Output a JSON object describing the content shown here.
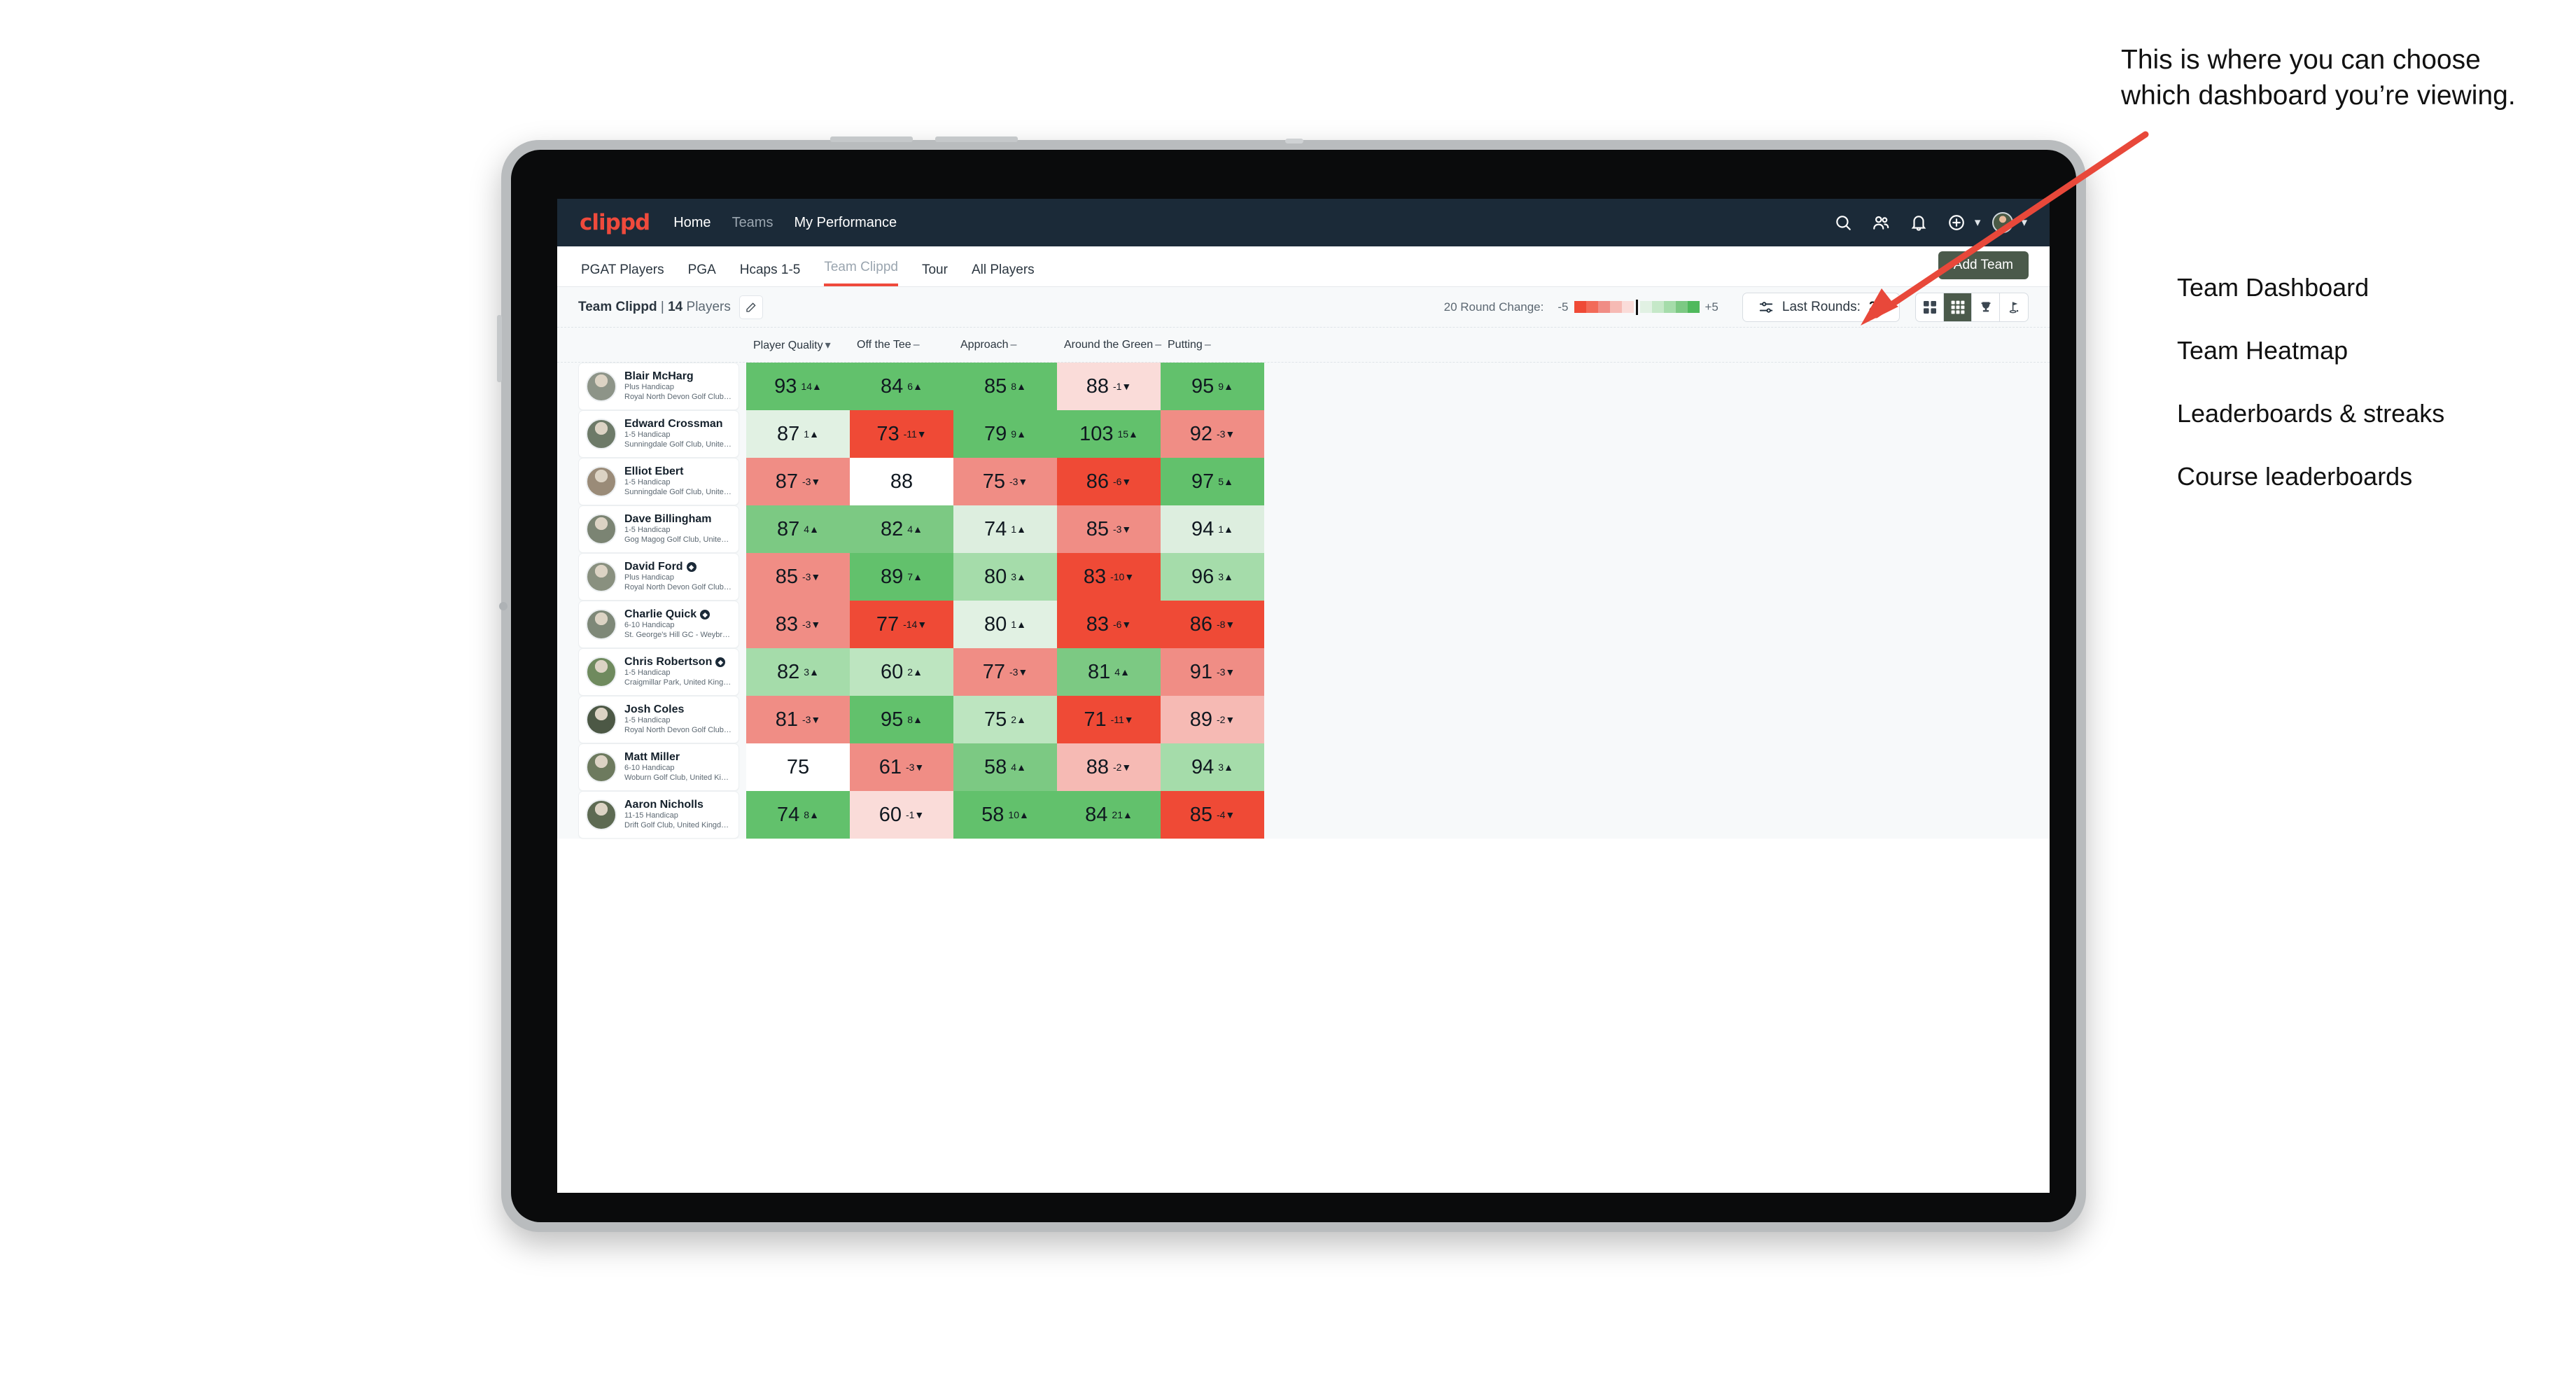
{
  "brand": "clippd",
  "topnav": {
    "links": [
      {
        "label": "Home",
        "dim": false
      },
      {
        "label": "Teams",
        "dim": true
      },
      {
        "label": "My Performance",
        "dim": false
      }
    ],
    "icons": [
      "search-icon",
      "people-icon",
      "bell-icon",
      "plus-circle-icon",
      "avatar"
    ]
  },
  "subnav": {
    "tabs": [
      {
        "label": "PGAT Players",
        "state": "dim-dark"
      },
      {
        "label": "PGA",
        "state": "dim-dark"
      },
      {
        "label": "Hcaps 1-5",
        "state": "dim-dark"
      },
      {
        "label": "Team Clippd",
        "state": "active"
      },
      {
        "label": "Tour",
        "state": "dim-dark"
      },
      {
        "label": "All Players",
        "state": "dim-dark"
      }
    ],
    "add_team_label": "Add Team"
  },
  "toolbar": {
    "team_name": "Team Clippd",
    "separator": "|",
    "player_count": "14",
    "players_label": "Players",
    "edit_icon": "pencil-icon",
    "round_change_label": "20 Round Change:",
    "scale_min": "-5",
    "scale_max": "+5",
    "last_rounds_label": "Last Rounds:",
    "last_rounds_value": "20",
    "filter_icon": "sliders-icon",
    "views": [
      {
        "name": "cards-view",
        "icon": "grid-2x2-icon",
        "active": false
      },
      {
        "name": "heatmap-view",
        "icon": "grid-3x3-icon",
        "active": true
      },
      {
        "name": "leaderboard-view",
        "icon": "trophy-icon",
        "active": false
      },
      {
        "name": "course-view",
        "icon": "flag-pin-icon",
        "active": false
      }
    ]
  },
  "columns": [
    {
      "label": "Player Quality",
      "marker": "chevron-down"
    },
    {
      "label": "Off the Tee",
      "marker": "dash"
    },
    {
      "label": "Approach",
      "marker": "dash"
    },
    {
      "label": "Around the Green",
      "marker": "dash"
    },
    {
      "label": "Putting",
      "marker": "dash"
    }
  ],
  "rows": [
    {
      "name": "Blair McHarg",
      "verified": false,
      "handicap": "Plus Handicap",
      "club": "Royal North Devon Golf Club, United Kingdom",
      "avatar": "#7f8d7a",
      "cells": [
        {
          "value": "93",
          "delta": "14",
          "dir": "up",
          "bg": "#61c濃"
        },
        {
          "value": "84",
          "delta": "6",
          "dir": "up",
          "bg": "#62c籠"
        },
        {
          "value": "85",
          "delta": "8",
          "dir": "up",
          "bg": "#62c籠"
        },
        {
          "value": "88",
          "delta": "-1",
          "dir": "down",
          "bg": "#f9d8d6"
        },
        {
          "value": "95",
          "delta": "9",
          "dir": "up",
          "bg": "#62c籠"
        }
      ]
    }
  ],
  "table": {
    "players": [
      {
        "name": "Blair McHarg",
        "verified": false,
        "handicap": "Plus Handicap",
        "club": "Royal North Devon Golf Club, United Kingdom",
        "avatar_color": "#8d9488"
      },
      {
        "name": "Edward Crossman",
        "verified": false,
        "handicap": "1-5 Handicap",
        "club": "Sunningdale Golf Club, United Kingdom",
        "avatar_color": "#6d7a68"
      },
      {
        "name": "Elliot Ebert",
        "verified": false,
        "handicap": "1-5 Handicap",
        "club": "Sunningdale Golf Club, United Kingdom",
        "avatar_color": "#9a8b78"
      },
      {
        "name": "Dave Billingham",
        "verified": false,
        "handicap": "1-5 Handicap",
        "club": "Gog Magog Golf Club, United Kingdom",
        "avatar_color": "#7b8473"
      },
      {
        "name": "David Ford",
        "verified": true,
        "handicap": "Plus Handicap",
        "club": "Royal North Devon Golf Club, United Kingdom",
        "avatar_color": "#89907f"
      },
      {
        "name": "Charlie Quick",
        "verified": true,
        "handicap": "6-10 Handicap",
        "club": "St. George's Hill GC - Weybridge - Surrey, Uni...",
        "avatar_color": "#7e8878"
      },
      {
        "name": "Chris Robertson",
        "verified": true,
        "handicap": "1-5 Handicap",
        "club": "Craigmillar Park, United Kingdom",
        "avatar_color": "#6f8a5e"
      },
      {
        "name": "Josh Coles",
        "verified": false,
        "handicap": "1-5 Handicap",
        "club": "Royal North Devon Golf Club, United Kingdom",
        "avatar_color": "#4c5845"
      },
      {
        "name": "Matt Miller",
        "verified": false,
        "handicap": "6-10 Handicap",
        "club": "Woburn Golf Club, United Kingdom",
        "avatar_color": "#6d7a5e"
      },
      {
        "name": "Aaron Nicholls",
        "verified": false,
        "handicap": "11-15 Handicap",
        "club": "Drift Golf Club, United Kingdom",
        "avatar_color": "#5d6a52"
      }
    ]
  },
  "chart_data": {
    "type": "heatmap",
    "title": "Team Clippd | 14 Players",
    "columns": [
      "Player Quality",
      "Off the Tee",
      "Approach",
      "Around the Green",
      "Putting"
    ],
    "row_labels": [
      "Blair McHarg",
      "Edward Crossman",
      "Elliot Ebert",
      "Dave Billingham",
      "David Ford",
      "Charlie Quick",
      "Chris Robertson",
      "Josh Coles",
      "Matt Miller",
      "Aaron Nicholls"
    ],
    "legend": {
      "label": "20 Round Change:",
      "min": "-5",
      "max": "+5"
    },
    "cells": [
      [
        {
          "value": 93,
          "delta": 14,
          "dir": "up",
          "bg": "#62c濃"
        },
        {
          "value": 84,
          "delta": 6,
          "dir": "up",
          "bg": "#62c濃"
        },
        {
          "value": 85,
          "delta": 8,
          "dir": "up",
          "bg": "#62c濃"
        },
        {
          "value": 88,
          "delta": -1,
          "dir": "down",
          "bg": "#fadcd9"
        },
        {
          "value": 95,
          "delta": 9,
          "dir": "up",
          "bg": "#62c濃"
        }
      ],
      [
        {
          "value": 87,
          "delta": 1,
          "dir": "up",
          "bg": "#e1f1e3"
        },
        {
          "value": 73,
          "delta": -11,
          "dir": "down",
          "bg": "#ef4a36"
        },
        {
          "value": 79,
          "delta": 9,
          "dir": "up",
          "bg": "#62c濃"
        },
        {
          "value": 103,
          "delta": 15,
          "dir": "up",
          "bg": "#62c濃"
        },
        {
          "value": 92,
          "delta": -3,
          "dir": "down",
          "bg": "#f08d85"
        }
      ],
      [
        {
          "value": 87,
          "delta": -3,
          "dir": "down",
          "bg": "#f08d85"
        },
        {
          "value": 88,
          "delta": null,
          "dir": "none",
          "bg": "#ffffff"
        },
        {
          "value": 75,
          "delta": -3,
          "dir": "down",
          "bg": "#f08d85"
        },
        {
          "value": 86,
          "delta": -6,
          "dir": "down",
          "bg": "#ef4a36"
        },
        {
          "value": 97,
          "delta": 5,
          "dir": "up",
          "bg": "#62c濃"
        }
      ],
      [
        {
          "value": 87,
          "delta": 4,
          "dir": "up",
          "bg": "#7cc983"
        },
        {
          "value": 82,
          "delta": 4,
          "dir": "up",
          "bg": "#7cc983"
        },
        {
          "value": 74,
          "delta": 1,
          "dir": "up",
          "bg": "#ddeedf"
        },
        {
          "value": 85,
          "delta": -3,
          "dir": "down",
          "bg": "#f08d85"
        },
        {
          "value": 94,
          "delta": 1,
          "dir": "up",
          "bg": "#ddeedf"
        }
      ],
      [
        {
          "value": 85,
          "delta": -3,
          "dir": "down",
          "bg": "#f08d85"
        },
        {
          "value": 89,
          "delta": 7,
          "dir": "up",
          "bg": "#62c濃"
        },
        {
          "value": 80,
          "delta": 3,
          "dir": "up",
          "bg": "#a5dcaa"
        },
        {
          "value": 83,
          "delta": -10,
          "dir": "down",
          "bg": "#ef4a36"
        },
        {
          "value": 96,
          "delta": 3,
          "dir": "up",
          "bg": "#a5dcaa"
        }
      ],
      [
        {
          "value": 83,
          "delta": -3,
          "dir": "down",
          "bg": "#f08d85"
        },
        {
          "value": 77,
          "delta": -14,
          "dir": "down",
          "bg": "#ef4a36"
        },
        {
          "value": 80,
          "delta": 1,
          "dir": "up",
          "bg": "#e1f1e3"
        },
        {
          "value": 83,
          "delta": -6,
          "dir": "down",
          "bg": "#ef4a36"
        },
        {
          "value": 86,
          "delta": -8,
          "dir": "down",
          "bg": "#ef4a36"
        }
      ],
      [
        {
          "value": 82,
          "delta": 3,
          "dir": "up",
          "bg": "#a5dcaa"
        },
        {
          "value": 60,
          "delta": 2,
          "dir": "up",
          "bg": "#bde5c0"
        },
        {
          "value": 77,
          "delta": -3,
          "dir": "down",
          "bg": "#f08d85"
        },
        {
          "value": 81,
          "delta": 4,
          "dir": "up",
          "bg": "#7cc983"
        },
        {
          "value": 91,
          "delta": -3,
          "dir": "down",
          "bg": "#f08d85"
        }
      ],
      [
        {
          "value": 81,
          "delta": -3,
          "dir": "down",
          "bg": "#f08d85"
        },
        {
          "value": 95,
          "delta": 8,
          "dir": "up",
          "bg": "#62c濃"
        },
        {
          "value": 75,
          "delta": 2,
          "dir": "up",
          "bg": "#bde5c0"
        },
        {
          "value": 71,
          "delta": -11,
          "dir": "down",
          "bg": "#ef4a36"
        },
        {
          "value": 89,
          "delta": -2,
          "dir": "down",
          "bg": "#f6bab4"
        }
      ],
      [
        {
          "value": 75,
          "delta": null,
          "dir": "none",
          "bg": "#ffffff"
        },
        {
          "value": 61,
          "delta": -3,
          "dir": "down",
          "bg": "#f08d85"
        },
        {
          "value": 58,
          "delta": 4,
          "dir": "up",
          "bg": "#7cc983"
        },
        {
          "value": 88,
          "delta": -2,
          "dir": "down",
          "bg": "#f6bab4"
        },
        {
          "value": 94,
          "delta": 3,
          "dir": "up",
          "bg": "#a5dcaa"
        }
      ],
      [
        {
          "value": 74,
          "delta": 8,
          "dir": "up",
          "bg": "#62c濃"
        },
        {
          "value": 60,
          "delta": -1,
          "dir": "down",
          "bg": "#fadcd9"
        },
        {
          "value": 58,
          "delta": 10,
          "dir": "up",
          "bg": "#62c濃"
        },
        {
          "value": 84,
          "delta": 21,
          "dir": "up",
          "bg": "#62c濃"
        },
        {
          "value": 85,
          "delta": -4,
          "dir": "down",
          "bg": "#ef4a36"
        }
      ]
    ]
  },
  "annotation": {
    "callout": "This is where you can choose which dashboard you’re viewing.",
    "items": [
      "Team Dashboard",
      "Team Heatmap",
      "Leaderboards & streaks",
      "Course leaderboards"
    ],
    "arrow_color": "#e8483a"
  },
  "colors": {
    "brand_red": "#ef4a3c",
    "nav_dark": "#1b2a38",
    "button_olive": "#4b5a4b",
    "heat_green_strong": "#62c籠",
    "heat_red_strong": "#ef4a36"
  }
}
